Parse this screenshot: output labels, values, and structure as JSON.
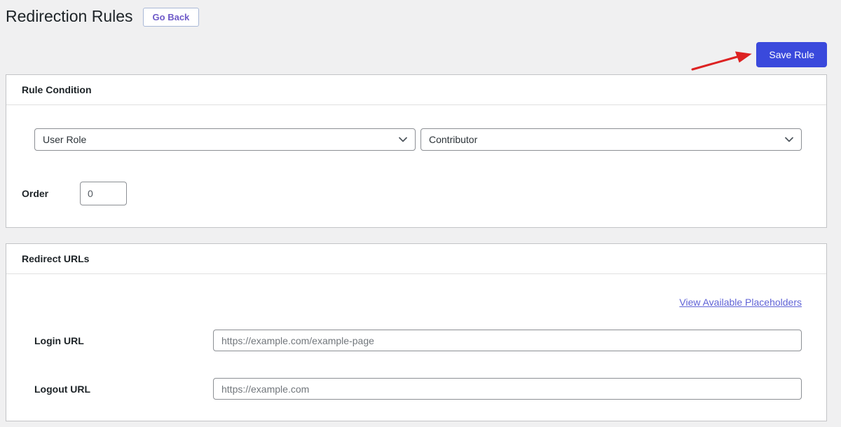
{
  "page": {
    "title": "Redirection Rules"
  },
  "header": {
    "go_back_label": "Go Back",
    "save_button_label": "Save Rule"
  },
  "rule_condition": {
    "section_title": "Rule Condition",
    "condition_type_selected": "User Role",
    "condition_value_selected": "Contributor",
    "order_label": "Order",
    "order_value": "0"
  },
  "redirect_urls": {
    "section_title": "Redirect URLs",
    "placeholders_link_label": "View Available Placeholders",
    "login_label": "Login URL",
    "login_placeholder": "https://example.com/example-page",
    "logout_label": "Logout URL",
    "logout_placeholder": "https://example.com"
  },
  "annotations": {
    "arrow_color": "#dd2222"
  },
  "colors": {
    "accent_blue": "#3a49dc",
    "link_purple": "#6063d6",
    "page_background": "#f0f0f1",
    "card_border": "#c3c4c7"
  }
}
